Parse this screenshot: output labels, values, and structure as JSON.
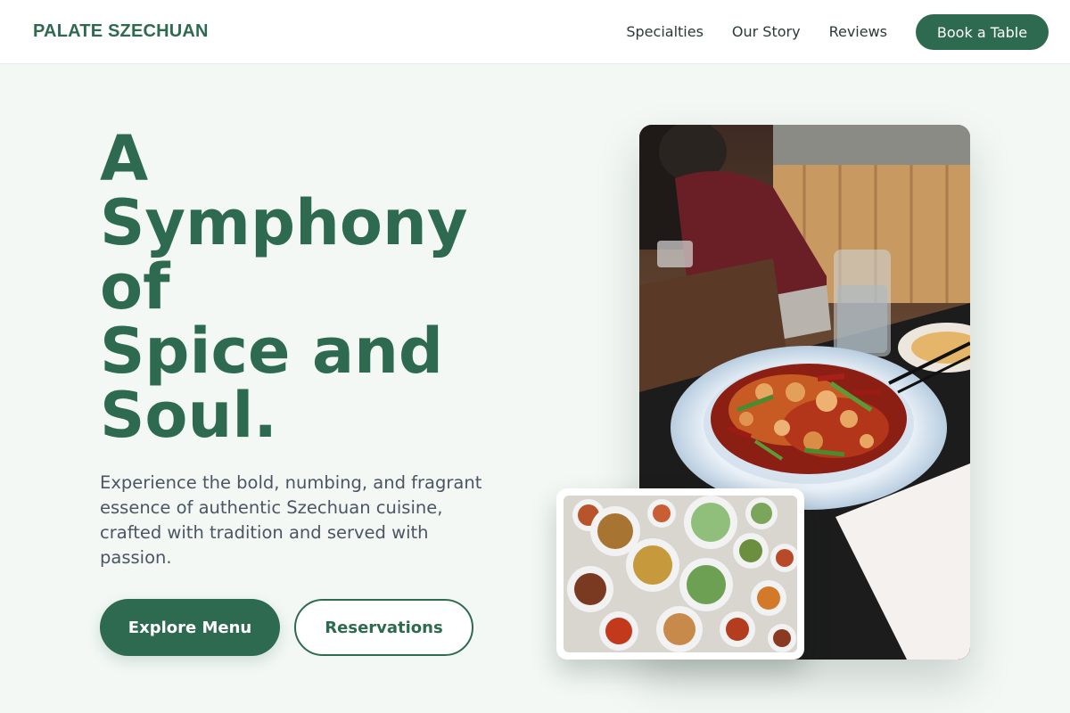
{
  "header": {
    "brand": "PALATE SZECHUAN",
    "nav": [
      {
        "label": "Specialties"
      },
      {
        "label": "Our Story"
      },
      {
        "label": "Reviews"
      }
    ],
    "cta_label": "Book a Table"
  },
  "hero": {
    "title_lines": [
      "A",
      "Symphony",
      "of",
      "Spice and",
      "Soul."
    ],
    "subtitle_lines": [
      "Experience the bold, numbing, and fragrant",
      "essence of authentic Szechuan cuisine,",
      "crafted with tradition and served with",
      "passion."
    ],
    "primary_button": "Explore Menu",
    "secondary_button": "Reservations"
  },
  "images": {
    "main": "photo of a spicy chili chicken dish on a plate in a restaurant",
    "inset": "overhead photo of a table spread with many dishes"
  },
  "colors": {
    "brand": "#2e6a50",
    "page_bg": "#f3f8f5",
    "body_text": "#4b5563"
  }
}
